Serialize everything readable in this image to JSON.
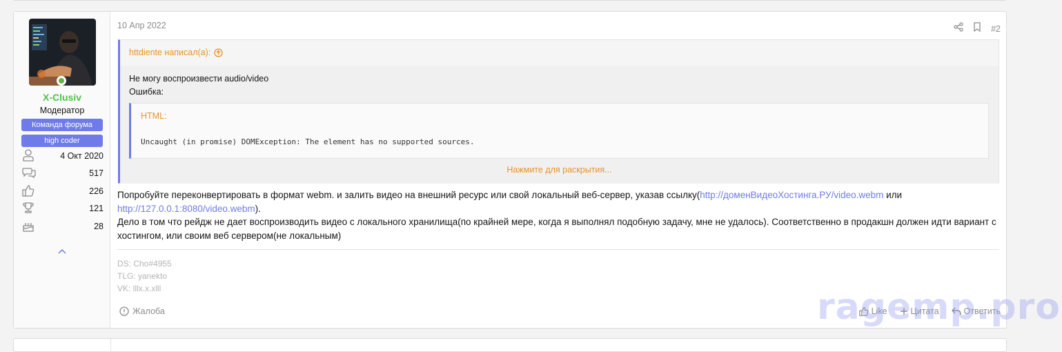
{
  "user": {
    "name": "X-Clusiv",
    "title": "Модератор",
    "banners": [
      "Команда форума",
      "high coder"
    ],
    "stats": [
      {
        "icon": "user-icon",
        "value": "4 Окт 2020"
      },
      {
        "icon": "messages-icon",
        "value": "517"
      },
      {
        "icon": "thumbs-up-icon",
        "value": "226"
      },
      {
        "icon": "trophy-icon",
        "value": "121"
      },
      {
        "icon": "cake-icon",
        "value": "28"
      }
    ]
  },
  "post": {
    "date": "10 Апр 2022",
    "number": "#2",
    "quote": {
      "author": "httdiente написал(а):",
      "lines": [
        "Не могу воспроизвести audio/video",
        "Ошибка:"
      ],
      "code_label": "HTML:",
      "code_line": "Uncaught (in promise) DOMException: The element has no supported sources.",
      "expand": "Нажмите для раскрытия..."
    },
    "message": {
      "p1_a": "Попробуйте переконвертировать в формат webm. и залить видео на внешний ресурс или свой локальный веб-сервер, указав ссылку(",
      "link1": "http://доменВидеоХостинга.РУ/video.webm",
      "p1_b": " или ",
      "link2": "http://127.0.0.1:8080/video.webm",
      "p1_c": ").",
      "p2": "Дело в том что рейдж не дает воспроизводить видео с локального хранилища(по крайней мере, когда я выполнял подобную задачу, мне не удалось). Соответственно в продакшн должен идти вариант с хостингом, или своим веб сервером(не локальным)"
    },
    "signature": [
      "DS: Cho#4955",
      "TLG: yanekto",
      "VK: lllx.x.xlll"
    ],
    "report": "Жалоба",
    "like": "Like",
    "quote_btn": "Цитата",
    "reply": "Ответить"
  },
  "watermark": "ragemp.pro",
  "colors": {
    "accent": "#6e7be8",
    "online": "#63b541",
    "username": "#4ec447",
    "quote_author": "#e8922b"
  }
}
